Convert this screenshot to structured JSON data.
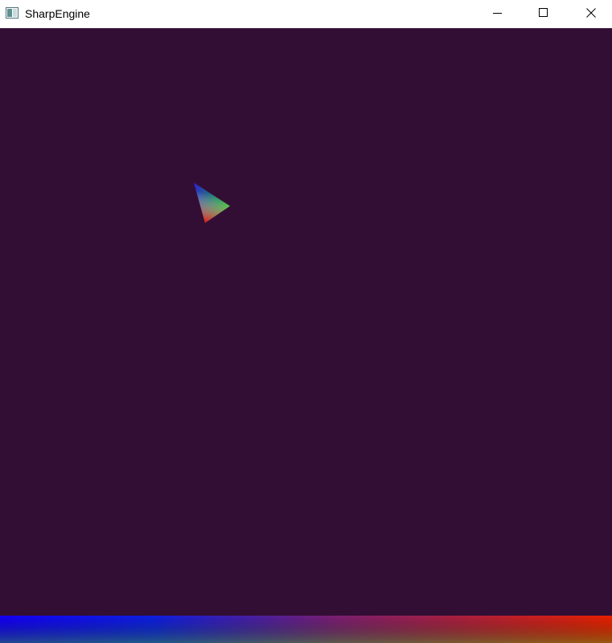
{
  "window": {
    "title": "SharpEngine",
    "app_icon": "window-app-icon",
    "controls": {
      "minimize_icon": "minimize-icon",
      "maximize_icon": "maximize-icon",
      "close_icon": "close-icon"
    }
  },
  "scene": {
    "background_color": "#330e34",
    "triangle": {
      "vertex_colors": [
        "#2c1fd8",
        "#15c41a",
        "#e01010"
      ]
    },
    "bottom_strip": {
      "colors": [
        "#1300f4",
        "#0d1fe0",
        "#7a1f70",
        "#e82000"
      ]
    }
  }
}
